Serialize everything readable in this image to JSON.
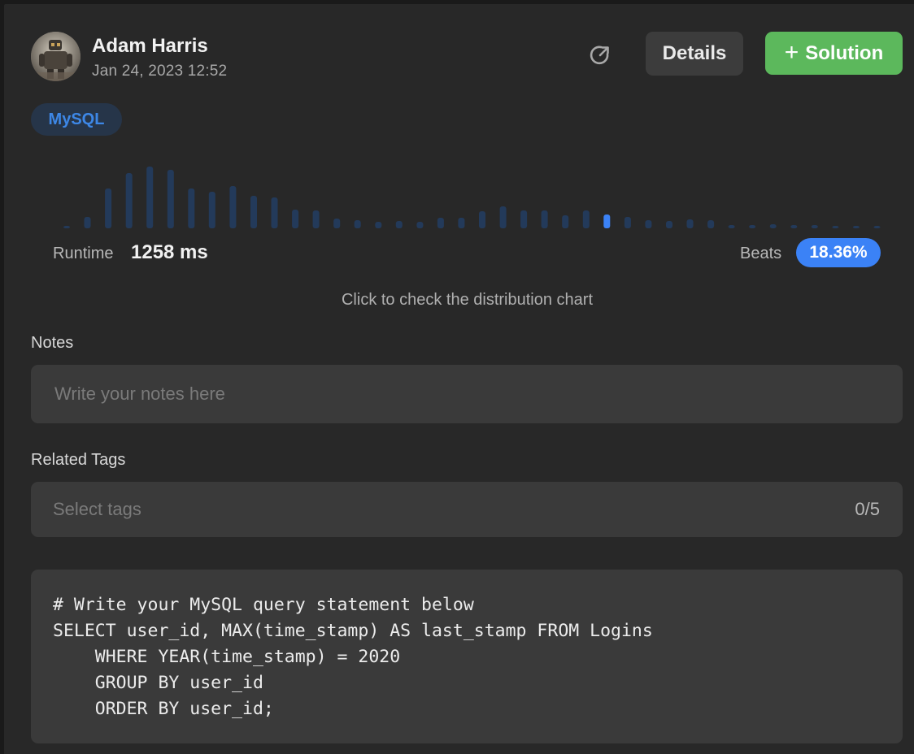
{
  "author": {
    "name": "Adam Harris",
    "date": "Jan 24, 2023 12:52"
  },
  "actions": {
    "details_label": "Details",
    "solution_label": "Solution"
  },
  "language_tag": "MySQL",
  "distribution": {
    "bar_color": "#233a5a",
    "highlight_color": "#3b82f6",
    "highlight_index": 26,
    "heights": [
      3,
      14,
      49,
      68,
      76,
      72,
      49,
      45,
      52,
      40,
      38,
      23,
      22,
      12,
      10,
      8,
      9,
      8,
      13,
      13,
      21,
      27,
      22,
      22,
      16,
      22,
      17,
      14,
      10,
      9,
      11,
      10,
      4,
      4,
      5,
      4,
      4,
      3,
      3,
      3
    ]
  },
  "runtime": {
    "label": "Runtime",
    "value": "1258 ms"
  },
  "beats": {
    "label": "Beats",
    "value": "18.36%"
  },
  "chart_hint": "Click to check the distribution chart",
  "notes": {
    "label": "Notes",
    "placeholder": "Write your notes here"
  },
  "related_tags": {
    "label": "Related Tags",
    "placeholder": "Select tags",
    "count": "0/5"
  },
  "code": [
    "# Write your MySQL query statement below",
    "SELECT user_id, MAX(time_stamp) AS last_stamp FROM Logins",
    "    WHERE YEAR(time_stamp) = 2020",
    "    GROUP BY user_id",
    "    ORDER BY user_id;"
  ],
  "colors": {
    "accent_blue": "#3b82f6",
    "solution_green": "#5cb85c",
    "panel_bg": "#282828"
  }
}
